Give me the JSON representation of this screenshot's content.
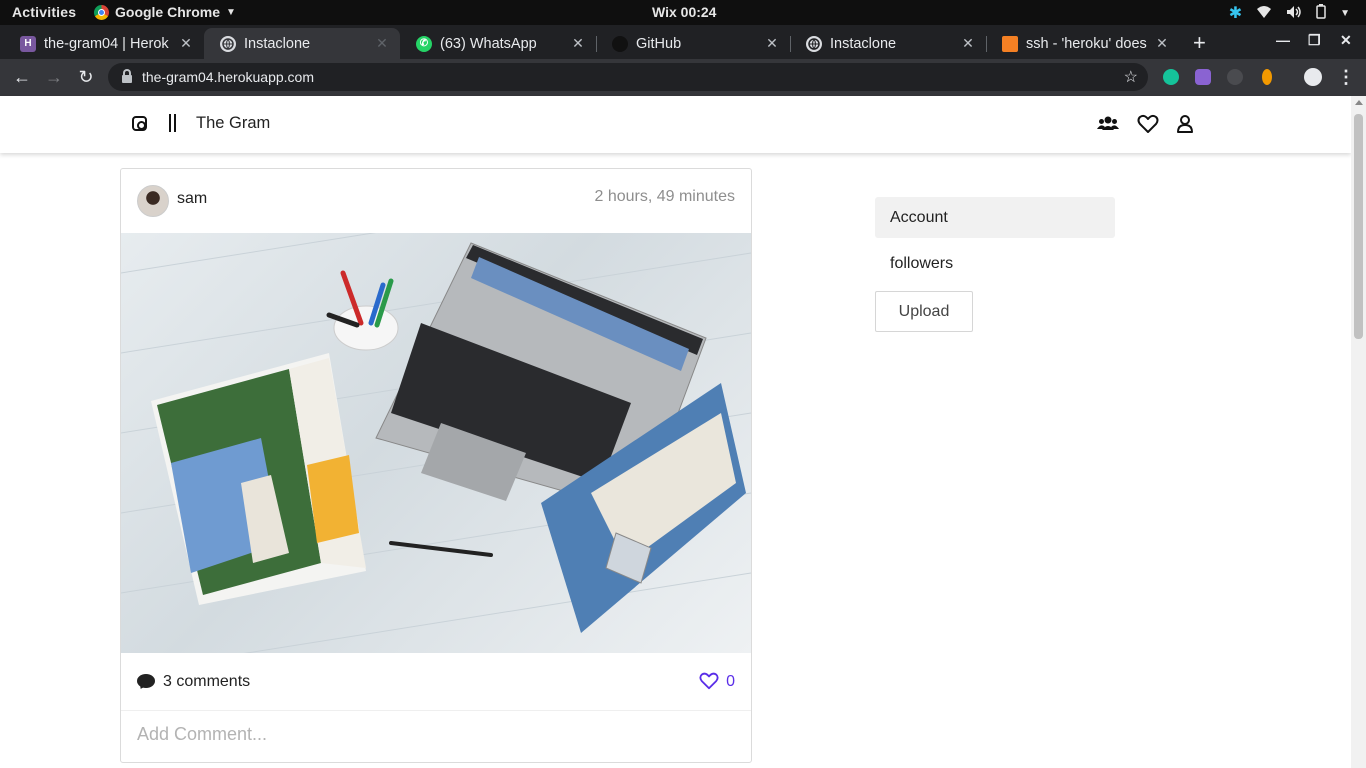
{
  "desktop": {
    "activities": "Activities",
    "app_name": "Google Chrome",
    "clock": "Wix 00:24"
  },
  "tabs": [
    {
      "title": "the-gram04 | Herok",
      "favicon": "heroku-icon",
      "favicon_color": "#79589f",
      "active": false
    },
    {
      "title": "Instaclone",
      "favicon": "globe-icon",
      "favicon_color": "#dadce0",
      "active": true
    },
    {
      "title": "(63) WhatsApp",
      "favicon": "whatsapp-icon",
      "favicon_color": "#25d366",
      "active": false
    },
    {
      "title": "GitHub",
      "favicon": "github-icon",
      "favicon_color": "#111111",
      "active": false
    },
    {
      "title": "Instaclone",
      "favicon": "globe-icon",
      "favicon_color": "#dadce0",
      "active": false
    },
    {
      "title": "ssh - 'heroku' does",
      "favicon": "stackoverflow-icon",
      "favicon_color": "#f48024",
      "active": false
    }
  ],
  "address_bar": {
    "url": "the-gram04.herokuapp.com"
  },
  "site": {
    "brand": "The Gram",
    "accent": "#5a2ee8"
  },
  "post": {
    "username": "sam",
    "time_ago": "2 hours, 49 minutes",
    "comments_label": "3 comments",
    "likes": "0",
    "comment_placeholder": "Add Comment..."
  },
  "sidebar": {
    "items": [
      {
        "label": "Account",
        "active": true
      },
      {
        "label": "followers",
        "active": false
      }
    ],
    "upload_label": "Upload"
  }
}
